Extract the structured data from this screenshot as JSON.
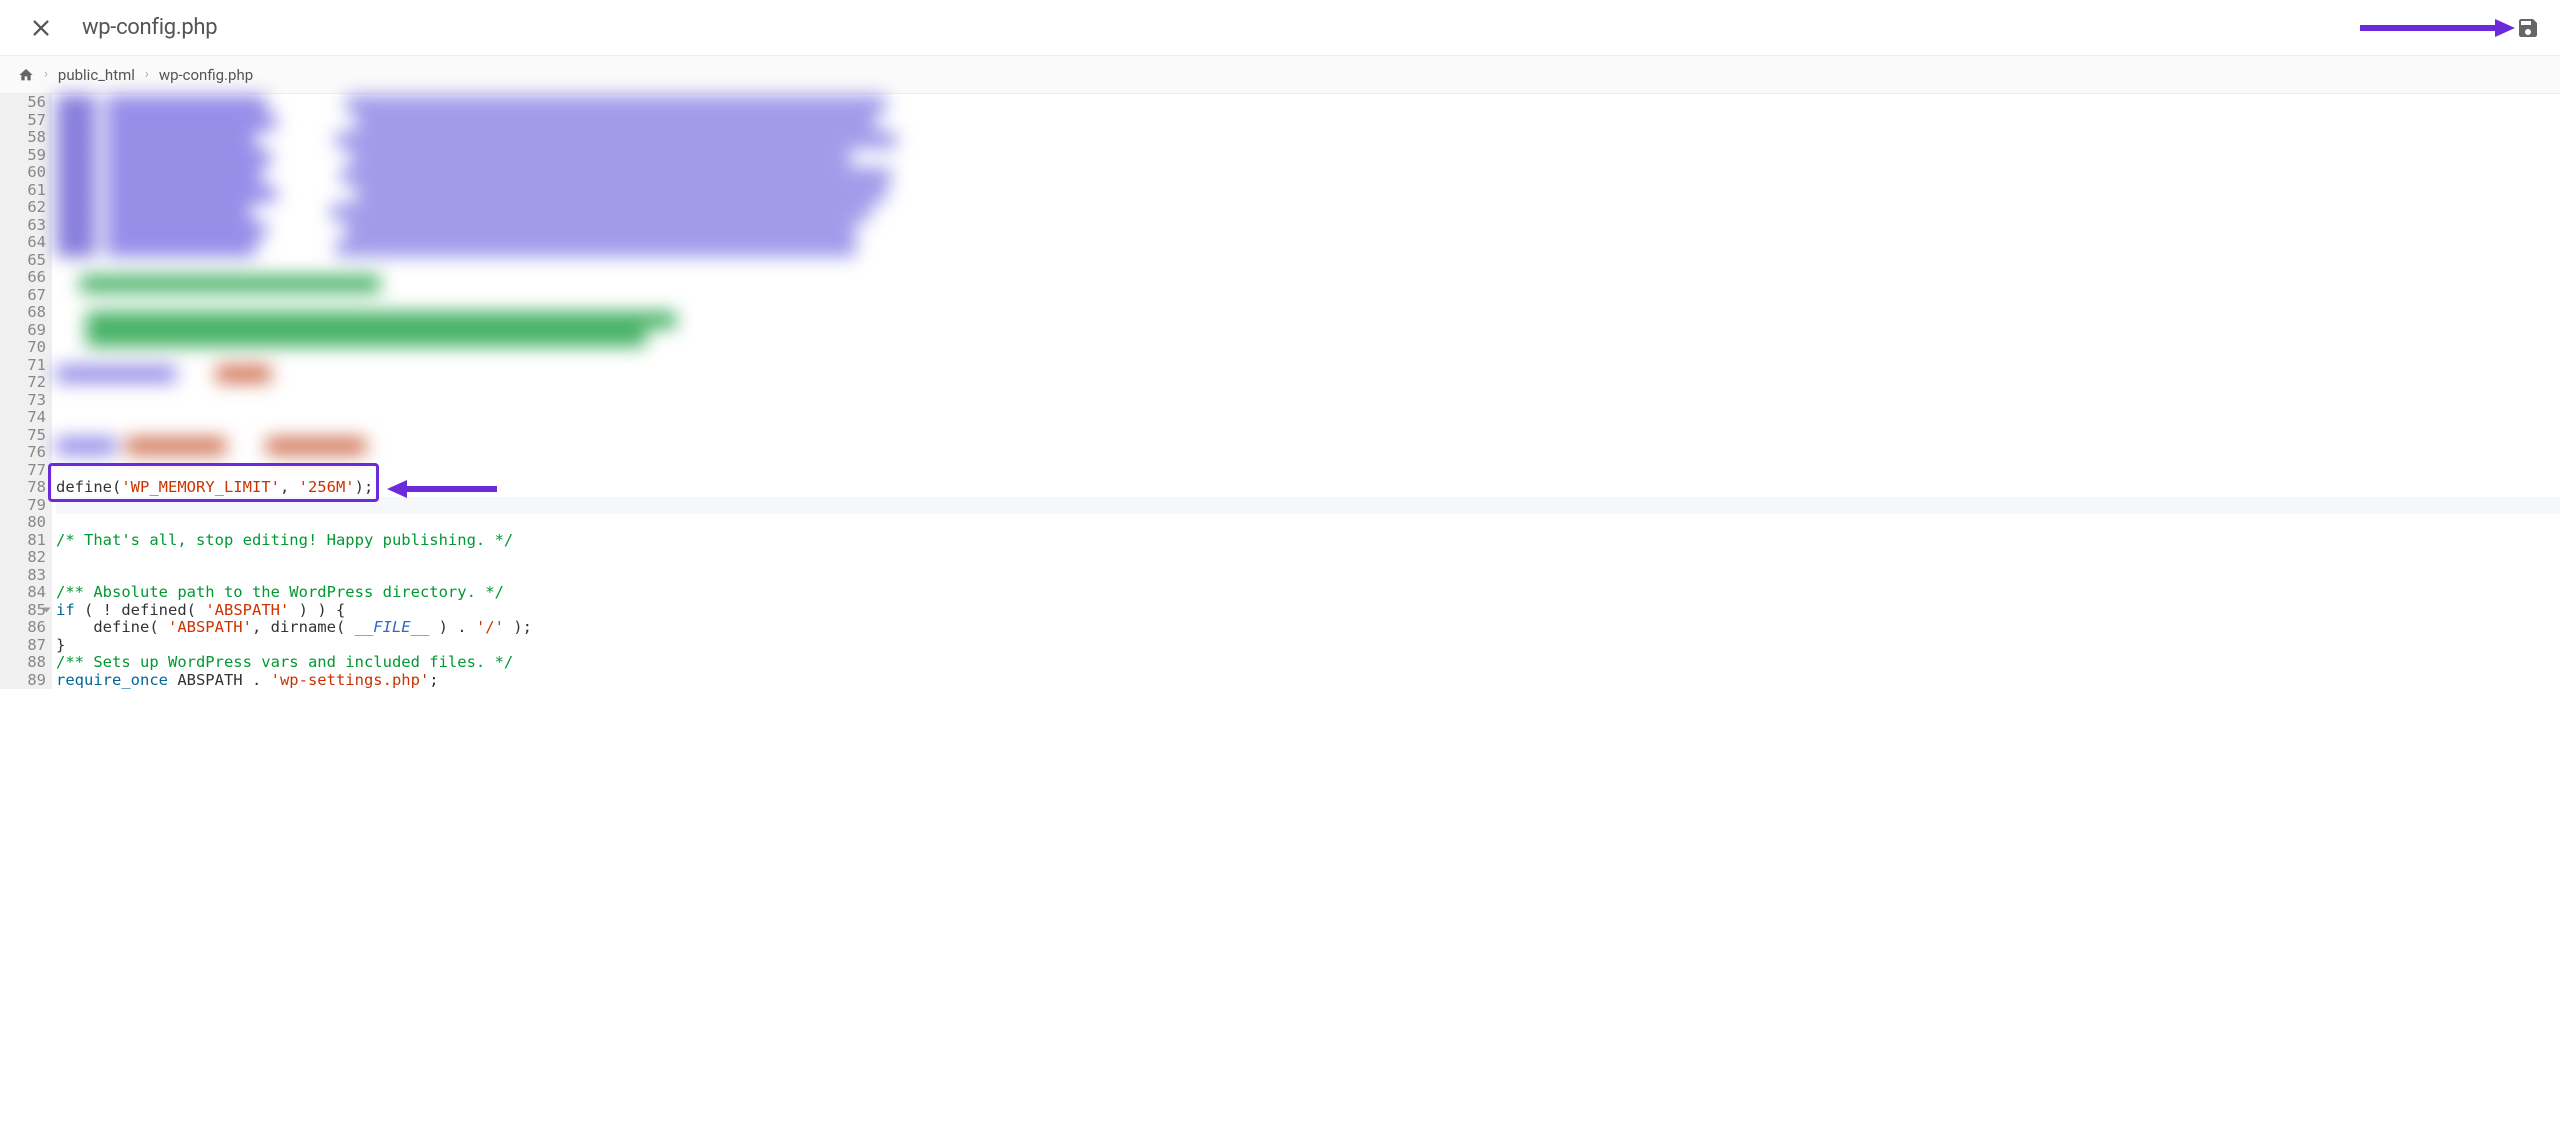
{
  "header": {
    "title": "wp-config.php"
  },
  "breadcrumb": {
    "items": [
      "public_html",
      "wp-config.php"
    ]
  },
  "editor": {
    "first_line_number": 56,
    "fold_line": 85,
    "lines": [
      {
        "n": 56,
        "segments": []
      },
      {
        "n": 57,
        "segments": []
      },
      {
        "n": 58,
        "segments": []
      },
      {
        "n": 59,
        "segments": []
      },
      {
        "n": 60,
        "segments": []
      },
      {
        "n": 61,
        "segments": []
      },
      {
        "n": 62,
        "segments": []
      },
      {
        "n": 63,
        "segments": []
      },
      {
        "n": 64,
        "segments": []
      },
      {
        "n": 65,
        "segments": []
      },
      {
        "n": 66,
        "segments": []
      },
      {
        "n": 67,
        "segments": []
      },
      {
        "n": 68,
        "segments": []
      },
      {
        "n": 69,
        "segments": []
      },
      {
        "n": 70,
        "segments": []
      },
      {
        "n": 71,
        "segments": []
      },
      {
        "n": 72,
        "segments": []
      },
      {
        "n": 73,
        "segments": []
      },
      {
        "n": 74,
        "segments": []
      },
      {
        "n": 75,
        "segments": []
      },
      {
        "n": 76,
        "segments": []
      },
      {
        "n": 77,
        "segments": []
      },
      {
        "n": 78,
        "segments": [
          {
            "t": "plain",
            "v": "define("
          },
          {
            "t": "str",
            "v": "'WP_MEMORY_LIMIT'"
          },
          {
            "t": "plain",
            "v": ", "
          },
          {
            "t": "str",
            "v": "'256M'"
          },
          {
            "t": "plain",
            "v": ");"
          }
        ]
      },
      {
        "n": 79,
        "segments": [],
        "cursor": true
      },
      {
        "n": 80,
        "segments": []
      },
      {
        "n": 81,
        "segments": [
          {
            "t": "cmt",
            "v": "/* That's all, stop editing! Happy publishing. */"
          }
        ]
      },
      {
        "n": 82,
        "segments": []
      },
      {
        "n": 83,
        "segments": []
      },
      {
        "n": 84,
        "segments": [
          {
            "t": "cmt",
            "v": "/** Absolute path to the WordPress directory. */"
          }
        ]
      },
      {
        "n": 85,
        "segments": [
          {
            "t": "kw",
            "v": "if"
          },
          {
            "t": "plain",
            "v": " ( ! defined( "
          },
          {
            "t": "str",
            "v": "'ABSPATH'"
          },
          {
            "t": "plain",
            "v": " ) ) {"
          }
        ]
      },
      {
        "n": 86,
        "segments": [
          {
            "t": "plain",
            "v": "    define( "
          },
          {
            "t": "str",
            "v": "'ABSPATH'"
          },
          {
            "t": "plain",
            "v": ", dirname( "
          },
          {
            "t": "const",
            "v": "__FILE__"
          },
          {
            "t": "plain",
            "v": " ) . "
          },
          {
            "t": "str",
            "v": "'/'"
          },
          {
            "t": "plain",
            "v": " );"
          }
        ]
      },
      {
        "n": 87,
        "segments": [
          {
            "t": "plain",
            "v": "}"
          }
        ]
      },
      {
        "n": 88,
        "segments": [
          {
            "t": "cmt",
            "v": "/** Sets up WordPress vars and included files. */"
          }
        ]
      },
      {
        "n": 89,
        "segments": [
          {
            "t": "kw",
            "v": "require_once"
          },
          {
            "t": "plain",
            "v": " ABSPATH . "
          },
          {
            "t": "str",
            "v": "'wp-settings.php'"
          },
          {
            "t": "plain",
            "v": ";"
          }
        ]
      }
    ]
  },
  "annotations": {
    "highlight_line": 78
  }
}
